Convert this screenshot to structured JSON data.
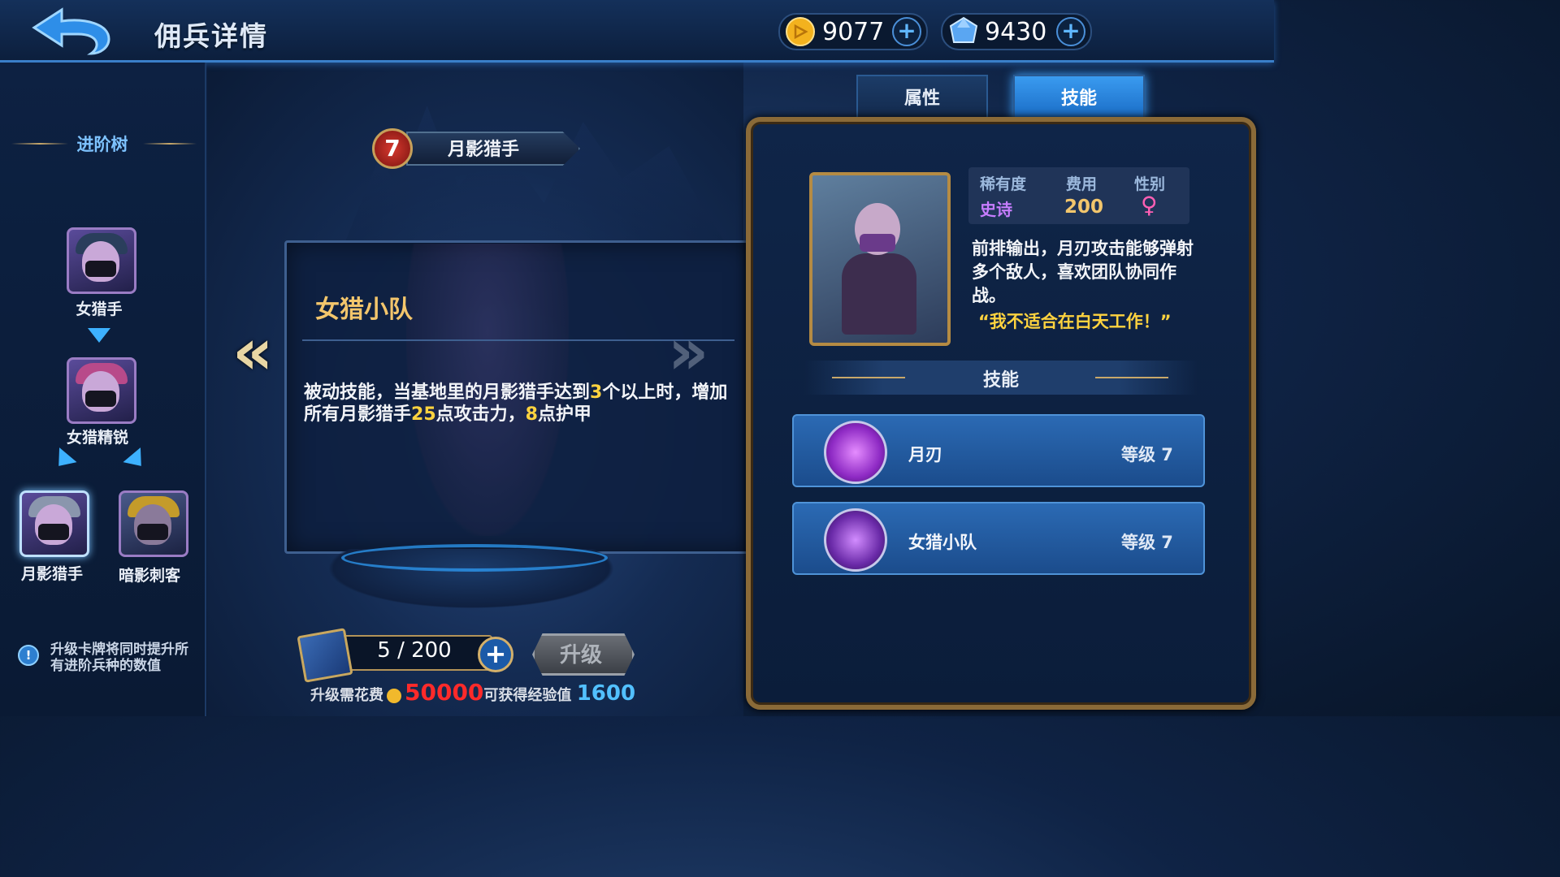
{
  "header": {
    "title": "佣兵详情",
    "gold": "9077",
    "gems": "9430"
  },
  "sidebar": {
    "tree_title": "进阶树",
    "units": [
      {
        "name": "女猎手"
      },
      {
        "name": "女猎精锐"
      },
      {
        "name": "月影猎手"
      },
      {
        "name": "暗影刺客"
      }
    ],
    "tip": "升级卡牌将同时提升所有进阶兵种的数值"
  },
  "hero": {
    "level": "7",
    "name": "月影猎手"
  },
  "skill_panel": {
    "title": "女猎小队",
    "desc": {
      "p1": "被动技能，当基地里的月影猎手达到",
      "n1": "3",
      "p2": "个以上时，增加所有月影猎手",
      "n2": "25",
      "p3": "点攻击力，",
      "n3": "8",
      "p4": "点护甲"
    }
  },
  "upgrade": {
    "cards": "5 / 200",
    "button": "升级",
    "cost_label": "升级需花费",
    "cost": "50000",
    "xp_label": "可获得经验值",
    "xp": "1600"
  },
  "tabs": {
    "attr": "属性",
    "skill": "技能"
  },
  "info": {
    "rarity_label": "稀有度",
    "rarity": "史诗",
    "cost_label": "费用",
    "cost": "200",
    "gender_label": "性别",
    "gender": "♀",
    "description": "前排输出，月刃攻击能够弹射多个敌人，喜欢团队协同作战。",
    "quote": "“我不适合在白天工作！”"
  },
  "skills": {
    "heading": "技能",
    "list": [
      {
        "name": "月刃",
        "level": "等级 7"
      },
      {
        "name": "女猎小队",
        "level": "等级 7"
      }
    ]
  },
  "colors": {
    "accent": "#3a9bf0",
    "gold": "#ffd33f",
    "epic": "#c77dff",
    "cost_red": "#ff2a2a"
  }
}
